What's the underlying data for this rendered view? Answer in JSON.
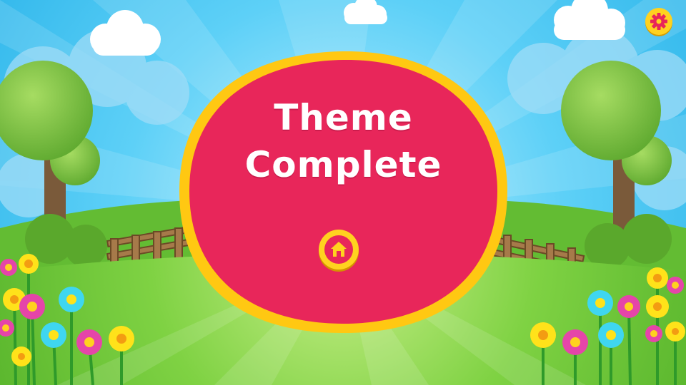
{
  "screen": {
    "title": "Theme\nComplete"
  },
  "buttons": {
    "settings_icon": "gear-icon",
    "home_icon": "home-icon"
  },
  "colors": {
    "sky": "#3ec3f2",
    "badge_fill": "#e8265a",
    "badge_border": "#ffc812",
    "button_yellow": "#ffd21f",
    "grass": "#6cc83a"
  }
}
